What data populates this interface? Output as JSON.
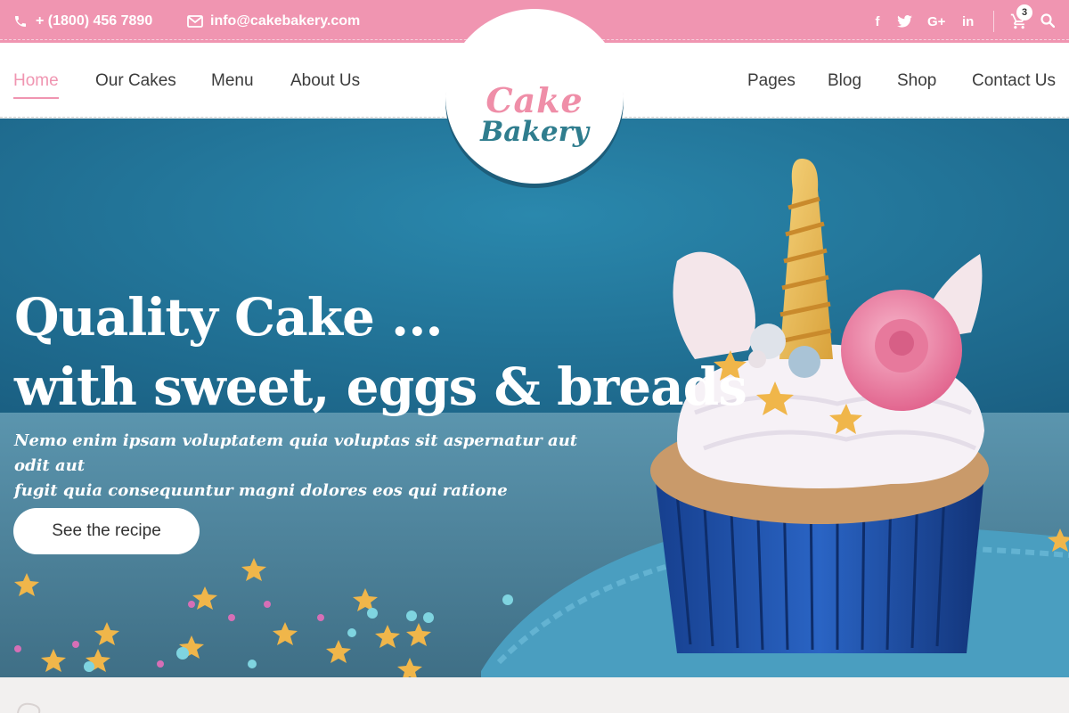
{
  "topbar": {
    "phone": "+ (1800) 456 7890",
    "email": "info@cakebakery.com",
    "social_facebook": "f",
    "social_twitter": "t",
    "social_google": "G+",
    "social_linkedin": "in",
    "cart_count": "3",
    "icons": [
      "phone-icon",
      "envelope-icon",
      "facebook-icon",
      "twitter-icon",
      "google-plus-icon",
      "linkedin-icon",
      "cart-icon",
      "search-icon"
    ]
  },
  "nav": {
    "left": [
      "Home",
      "Our Cakes",
      "Menu",
      "About Us"
    ],
    "right": [
      "Pages",
      "Blog",
      "Shop",
      "Contact Us"
    ],
    "active": "Home"
  },
  "logo": {
    "line1": "Cake",
    "line2": "Bakery"
  },
  "hero": {
    "title_line1": "Quality Cake ...",
    "title_line2": "with sweet, eggs & breads",
    "subtitle_line1": "Nemo enim ipsam voluptatem quia voluptas sit aspernatur aut odit aut",
    "subtitle_line2": "fugit quia consequuntur magni dolores eos qui ratione",
    "button": "See the recipe"
  },
  "colors": {
    "accent": "#f095b1",
    "hero_blue": "#2780a5",
    "text": "#3c3c3c"
  }
}
